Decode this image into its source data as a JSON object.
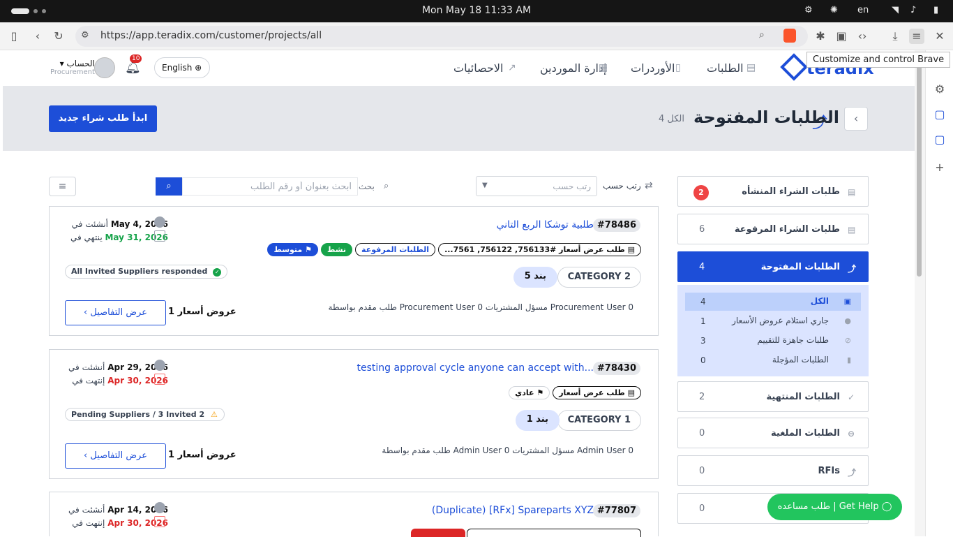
{
  "os": {
    "clock": "Mon May 18  11:33 AM",
    "lang": "en"
  },
  "browser": {
    "url": "https://app.teradix.com/customer/projects/all",
    "tooltip": "Customize and control Brave"
  },
  "header": {
    "logo": "teradix",
    "nav": [
      {
        "label": "الطلبات",
        "icon": "inbox-icon"
      },
      {
        "label": "الأوردرات",
        "icon": "document-icon"
      },
      {
        "label": "إدارة الموردين",
        "icon": "table-icon"
      },
      {
        "label": "الاحصائيات",
        "icon": "chart-icon"
      }
    ],
    "language": "English",
    "notifications": "10",
    "account": {
      "label": "الحساب",
      "role": "Procurement"
    }
  },
  "banner": {
    "title": "الطلبات المفتوحة",
    "count": "4 الكل",
    "new_request": "ابدأ طلب شراء جديد"
  },
  "toolbar": {
    "sort_label": "رتب حسب",
    "sort_placeholder": "رتب حسب",
    "search_label": "بحث",
    "search_placeholder": "ابحث بعنوان أو رقم الطلب"
  },
  "cards": [
    {
      "id": "#78486",
      "title": "طلبية توشكا الربع التاني",
      "tags": [
        "طلب عرض أسعار  #756133, 756122, 7561...",
        "الطلبات المرفوعة",
        "نشط",
        "متوسط"
      ],
      "category": "CATEGORY 2",
      "items": "5 بند",
      "meta": "طلب مقدم بواسطة Procurement User 0    مسؤل المشتريات Procurement User 0",
      "created_label": "أنشئت في",
      "created": "May 4, 2026",
      "ends_label": "ينتهي في",
      "ends": "May 31, 2026",
      "status": "All Invited Suppliers responded",
      "offers": "1 عروض أسعار",
      "details": "عرض التفاصيل"
    },
    {
      "id": "#78430",
      "title": "testing approval cycle anyone can accept with...",
      "tags": [
        "طلب عرض أسعار",
        "عادي"
      ],
      "category": "CATEGORY 1",
      "items": "1 بند",
      "meta": "طلب مقدم بواسطة Admin User 0    مسؤل المشتريات Admin User 0",
      "created_label": "أنشئت في",
      "created": "Apr 29, 2026",
      "ends_label": "إنتهت في",
      "ends": "Apr 30, 2026",
      "status": "Pending Suppliers / 3 Invited 2",
      "offers": "1 عروض أسعار",
      "details": "عرض التفاصيل"
    },
    {
      "id": "#77807",
      "title": "(Duplicate) [RFx] Spareparts XYZ",
      "created_label": "أنشئت في",
      "created": "Apr 14, 2026",
      "ends_label": "إنتهت في",
      "ends": "Apr 30, 2026"
    }
  ],
  "sidebar": [
    {
      "label": "طلبات الشراء المنشأه",
      "count": "2"
    },
    {
      "label": "طلبات الشراء المرفوعة",
      "count": "6"
    },
    {
      "label": "الطلبات المفتوحة",
      "count": "4"
    },
    {
      "label": "الطلبات المنتهية",
      "count": "2"
    },
    {
      "label": "الطلبات الملغية",
      "count": "0"
    },
    {
      "label": "RFIs",
      "count": "0"
    },
    {
      "label": "",
      "count": "0"
    }
  ],
  "subnav": [
    {
      "label": "الكل",
      "count": "4"
    },
    {
      "label": "جاري استلام عروض الأسعار",
      "count": "1"
    },
    {
      "label": "طلبات جاهزة للتقييم",
      "count": "3"
    },
    {
      "label": "الطلبات المؤجلة",
      "count": "0"
    }
  ],
  "help": "طلب مساعده | Get Help"
}
